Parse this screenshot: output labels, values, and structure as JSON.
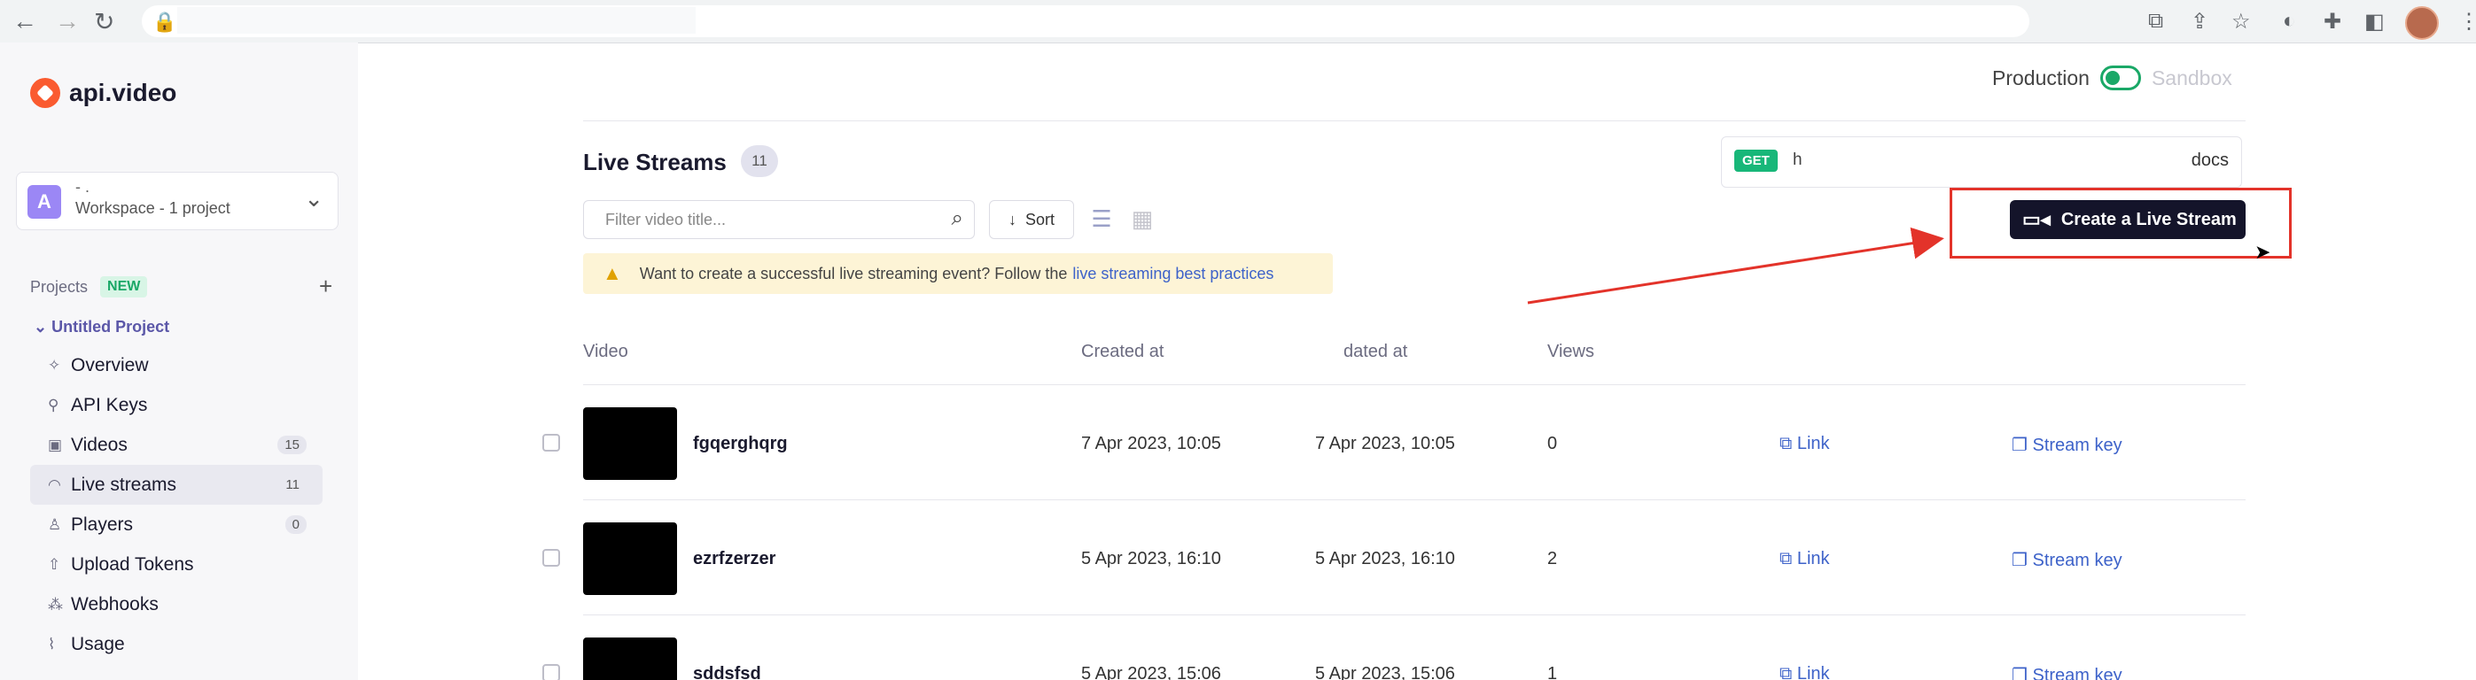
{
  "browser": {
    "back_glyph": "←",
    "forward_glyph": "→",
    "reload_glyph": "↻",
    "lock_glyph": "🔒",
    "ext_icons": [
      "translate-icon",
      "share-icon",
      "star-icon",
      "extension-a-icon",
      "puzzle-icon",
      "sidepanel-icon"
    ]
  },
  "sidebar": {
    "brand": "api.video",
    "workspace": {
      "avatar": "A",
      "title": "- .",
      "subtitle": "Workspace - 1 project",
      "chevron": "⌄"
    },
    "projects_label": "Projects",
    "projects_badge": "NEW",
    "add_glyph": "+",
    "project_name": "Untitled Project",
    "items": [
      {
        "label": "Overview",
        "icon": "✧",
        "count": ""
      },
      {
        "label": "API Keys",
        "icon": "⚲",
        "count": ""
      },
      {
        "label": "Videos",
        "icon": "▣",
        "count": "15"
      },
      {
        "label": "Live streams",
        "icon": "◠",
        "count": "11"
      },
      {
        "label": "Players",
        "icon": "♙",
        "count": "0"
      },
      {
        "label": "Upload Tokens",
        "icon": "⇧",
        "count": ""
      },
      {
        "label": "Webhooks",
        "icon": "⁂",
        "count": ""
      },
      {
        "label": "Usage",
        "icon": "⌇",
        "count": ""
      }
    ]
  },
  "env": {
    "production": "Production",
    "sandbox": "Sandbox"
  },
  "main": {
    "title": "Live Streams",
    "count": "11",
    "api": {
      "method": "GET",
      "path": "h",
      "docs": "docs"
    },
    "search_placeholder": "Filter video title...",
    "search_glyph": "⌕",
    "sort_label": "Sort",
    "sort_glyph": "↓",
    "list_glyph": "☰",
    "grid_glyph": "▦",
    "create_label": "Create a Live Stream",
    "create_glyph": "▭◂",
    "banner_text": "Want to create a successful live streaming event? Follow the",
    "banner_link": "live streaming best practices",
    "banner_glyph": "▲",
    "columns": {
      "video": "Video",
      "created": "Created at",
      "updated": "dated at",
      "views": "Views"
    },
    "link_label": "Link",
    "link_glyph": "⧉",
    "streamkey_label": "Stream key",
    "streamkey_glyph": "❐",
    "rows": [
      {
        "name": "fgqerghqrg",
        "created": "7 Apr 2023, 10:05",
        "updated": "7 Apr 2023, 10:05",
        "views": "0"
      },
      {
        "name": "ezrfzerzer",
        "created": "5 Apr 2023, 16:10",
        "updated": "5 Apr 2023, 16:10",
        "views": "2"
      },
      {
        "name": "sddsfsd",
        "created": "5 Apr 2023, 15:06",
        "updated": "5 Apr 2023, 15:06",
        "views": "1"
      }
    ]
  },
  "colors": {
    "accent": "#14142a",
    "brand": "#fa5b30",
    "highlight": "#e3332a",
    "get_badge": "#18b779"
  }
}
